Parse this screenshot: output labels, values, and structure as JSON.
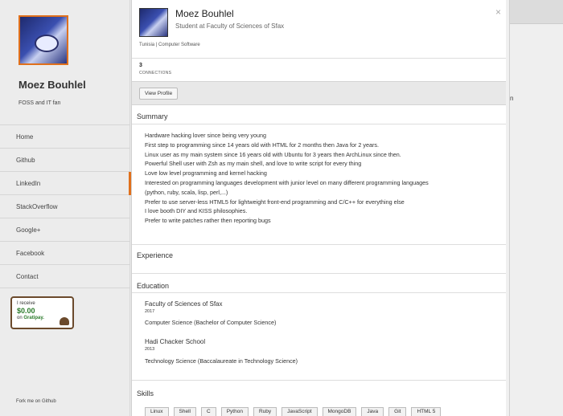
{
  "sidebar": {
    "name": "Moez Bouhlel",
    "tagline": "FOSS and IT fan",
    "nav": [
      "Home",
      "Github",
      "LinkedIn",
      "StackOverflow",
      "Google+",
      "Facebook",
      "Contact"
    ],
    "active_nav": "LinkedIn",
    "gratipay": {
      "line1": "I receive",
      "amount": "$0.00",
      "on": "on",
      "brand": "Gratipay."
    },
    "fork": "Fork me on Github"
  },
  "background": {
    "letter": "n"
  },
  "modal": {
    "close": "×",
    "name": "Moez Bouhlel",
    "headline": "Student at Faculty of Sciences of Sfax",
    "location": "Tunisia | Computer Software",
    "connections_count": "3",
    "connections_label": "CONNECTIONS",
    "view_profile": "View Profile",
    "summary_title": "Summary",
    "summary": [
      "Hardware hacking lover since being very young",
      "First step to programming since 14 years old with HTML for 2 months then Java for 2 years.",
      "Linux user as my main system since 16 years old with Ubuntu for 3 years then ArchLinux since then.",
      "Powerful Shell user with Zsh as my main shell, and love to write script for every thing",
      "Love low level programming and kernel hacking",
      "Interested on programming languages development with junior level on many different programming languages",
      "(python, ruby, scala, lisp, perl,...)",
      "Prefer to use server-less HTML5 for lightweight front-end programming and C/C++ for everything else",
      "I love booth DIY and KISS philosophies.",
      "Prefer to write patches rather then reporting bugs"
    ],
    "experience_title": "Experience",
    "education_title": "Education",
    "education": [
      {
        "school": "Faculty of Sciences of Sfax",
        "year": "2017",
        "degree": "Computer Science (Bachelor of Computer Science)"
      },
      {
        "school": "Hadi Chacker School",
        "year": "2013",
        "degree": "Technology Science (Baccalaureate in Technology Science)"
      }
    ],
    "skills_title": "Skills",
    "skills": [
      "Linux",
      "Shell",
      "C",
      "Python",
      "Ruby",
      "JavaScript",
      "MongoDB",
      "Java",
      "Git",
      "HTML 5"
    ]
  }
}
